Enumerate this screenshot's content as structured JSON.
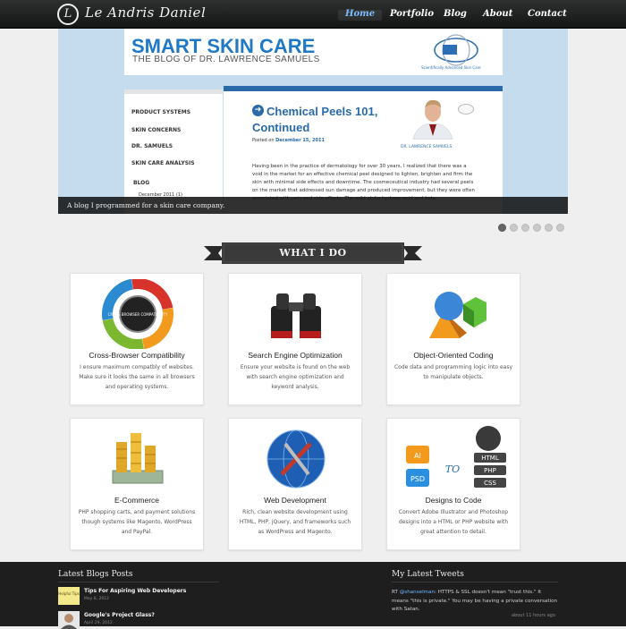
{
  "header": {
    "logo_letter": "L",
    "brand": "Le Andris Daniel",
    "nav": [
      "Home",
      "Portfolio",
      "Blog",
      "About",
      "Contact"
    ],
    "active": "Home"
  },
  "slider": {
    "site_title": "SMART SKIN CARE",
    "site_subtitle": "THE BLOG OF DR. LAWRENCE SAMUELS",
    "rx_logo_text": "Rx systems",
    "rx_tagline": "Scientifically Advanced Skin Care",
    "menu": [
      "PRODUCT SYSTEMS",
      "SKIN CONCERNS",
      "DR. SAMUELS",
      "SKIN CARE ANALYSIS"
    ],
    "blog_label": "BLOG",
    "archive_item": "December 2011 (1)",
    "post_title": "Chemical Peels 101, Continued",
    "posted_on": "Posted on",
    "post_date": "December 15, 2011",
    "doctor_caption": "DR. LAWRENCE SAMUELS",
    "post_body": "Having been in the practice of dermatology for over 30 years, I realized that there was a void in the market for an effective chemical peel designed to lighten, brighten and firm the skin with minimal side effects and downtime. The cosmeceutical industry had several peels on the market that addressed sun damage and produced improvement, but they were often associated with pain and side effects. The mild alpha hydroxy acid and beta",
    "caption": "A blog I programmed for a skin care company.",
    "slide_count": 6,
    "active_slide": 1
  },
  "section_title": "WHAT I DO",
  "services": [
    {
      "icon": "cross-browser-cycle-icon",
      "title": "Cross-Browser Compatibility",
      "desc": "I ensure maximum compatbly of websites. Make sure it looks the same in all browsers and operating systems."
    },
    {
      "icon": "binoculars-icon",
      "title": "Search Engine Optimization",
      "desc": "Ensure your website is found on the web with search engine optimization and keyword analysis."
    },
    {
      "icon": "geometric-shapes-icon",
      "title": "Object-Oriented Coding",
      "desc": "Code data and programming logic into easy to manipulate objects."
    },
    {
      "icon": "money-coins-icon",
      "title": "E-Commerce",
      "desc": "PHP shopping carts, and payment solutions though systems like Magento, WordPress and PayPal."
    },
    {
      "icon": "globe-tools-icon",
      "title": "Web Development",
      "desc": "Rich, clean website development using HTML, PHP, jQuery, and frameworks such as WordPress and Magento."
    },
    {
      "icon": "design-to-code-icon",
      "title": "Designs to Code",
      "desc": "Convert Adobe Illustrator and Photoshop designs into a HTML or PHP website with great attention to detail."
    }
  ],
  "design_badges": {
    "ai": "AI",
    "psd": "PSD",
    "to": "TO",
    "html": "HTML",
    "php": "PHP",
    "css": "CSS"
  },
  "cross_browser_badge": "CROSS BROWSER COMPATIBILITY",
  "footer": {
    "blogs_heading": "Latest Blogs Posts",
    "posts": [
      {
        "title": "Tips For Aspiring Web Developers",
        "date": "May 8, 2012",
        "thumb_text": "Helpful Tips"
      },
      {
        "title": "Google's Project Glass?",
        "date": "April 29, 2012"
      }
    ],
    "tweets_heading": "My Latest Tweets",
    "tweet_prefix": "RT ",
    "tweet_handle": "@shanselman",
    "tweet_text": ": HTTPS & SSL doesn't mean \"trust this.\" It means \"this is private.\" You may be having a private conversation with Satan.",
    "tweet_time": "about 11 hours ago"
  },
  "colors": {
    "accent_blue": "#2a6aa8",
    "nav_active": "#6fb7ff",
    "footer_bg": "#1e1e1e"
  }
}
